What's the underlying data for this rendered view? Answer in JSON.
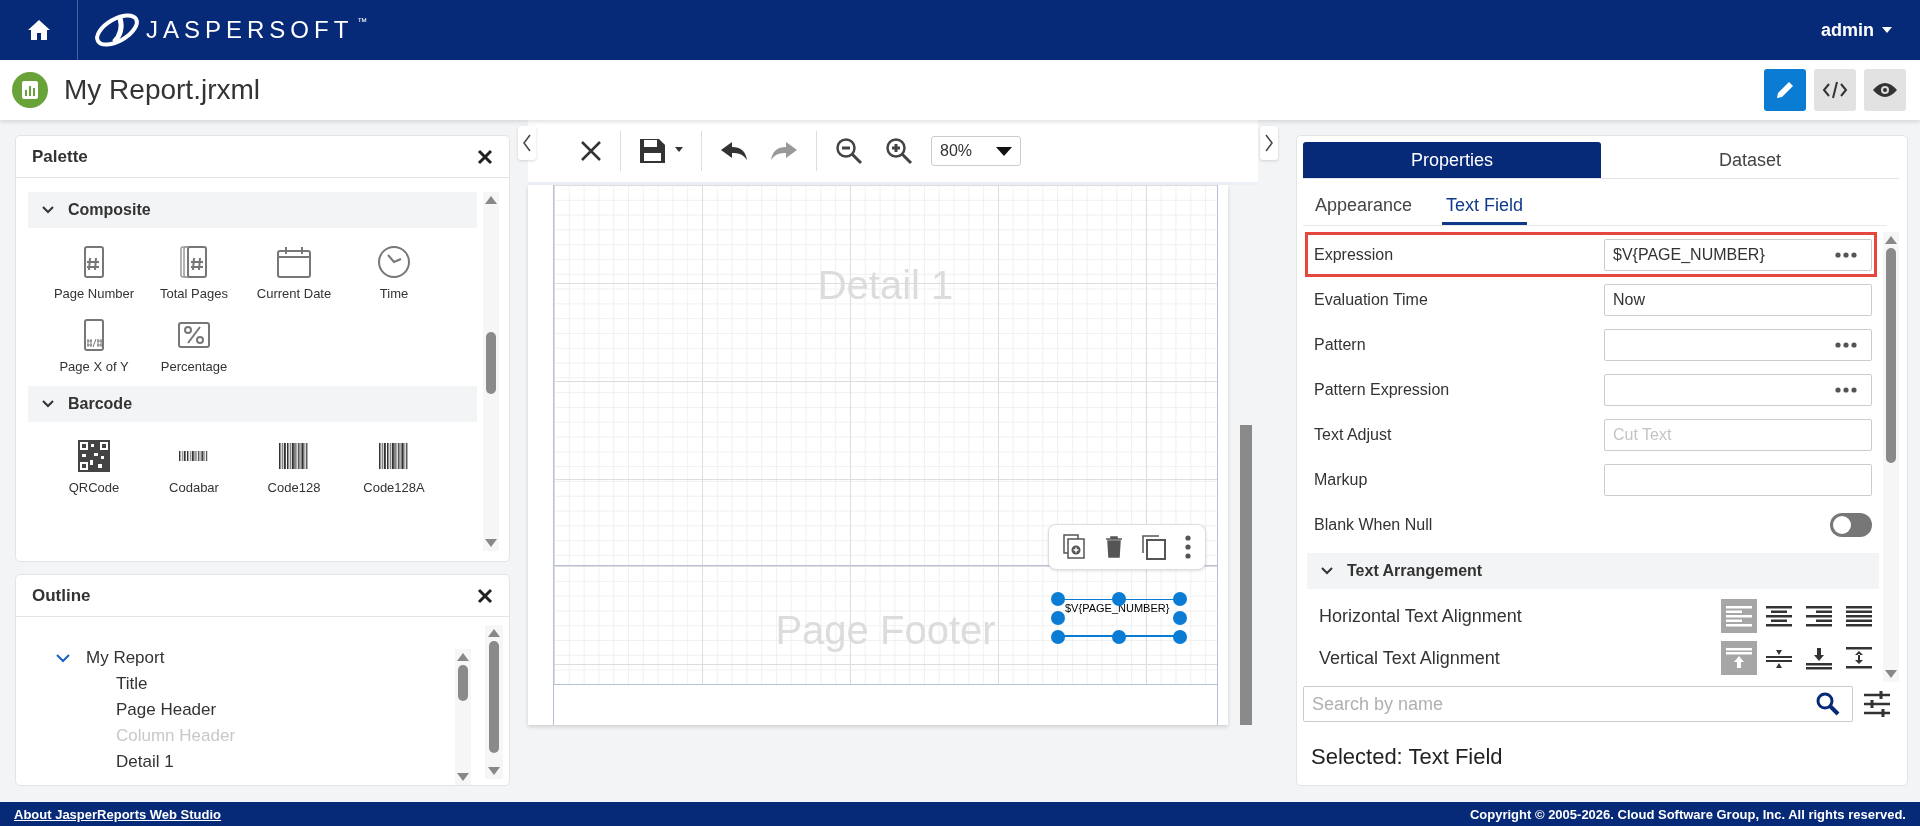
{
  "top_bar": {
    "brand": "JASPERSOFT",
    "trademark": "™",
    "user": "admin"
  },
  "title_bar": {
    "title": "My Report.jrxml",
    "modes": [
      {
        "kind": "design",
        "selected": true
      },
      {
        "kind": "source",
        "selected": false
      },
      {
        "kind": "preview",
        "selected": false
      }
    ]
  },
  "palette": {
    "title": "Palette",
    "sections": [
      {
        "label": "Composite",
        "expanded": true,
        "items": [
          {
            "kind": "page-number",
            "label": "Page Number"
          },
          {
            "kind": "total-pages",
            "label": "Total Pages"
          },
          {
            "kind": "date",
            "label": "Current Date"
          },
          {
            "kind": "time",
            "label": "Time"
          },
          {
            "kind": "page-x-of-y",
            "label": "Page X of Y"
          },
          {
            "kind": "percentage",
            "label": "Percentage"
          }
        ]
      },
      {
        "label": "Barcode",
        "expanded": true,
        "items": [
          {
            "kind": "qrcode",
            "label": "QRCode"
          },
          {
            "kind": "codabar",
            "label": "Codabar"
          },
          {
            "kind": "code128",
            "label": "Code128"
          },
          {
            "kind": "code128a",
            "label": "Code128A"
          }
        ]
      }
    ]
  },
  "outline": {
    "title": "Outline",
    "tree": [
      {
        "label": "My Report",
        "expanded": true,
        "disabled": false,
        "children": [
          {
            "label": "Title",
            "disabled": false
          },
          {
            "label": "Page Header",
            "disabled": false
          },
          {
            "label": "Column Header",
            "disabled": true
          },
          {
            "label": "Detail 1",
            "disabled": false
          }
        ]
      }
    ]
  },
  "toolbar": {
    "zoom": "80%"
  },
  "canvas": {
    "bands": [
      {
        "kind": "detail",
        "label": "Detail 1"
      },
      {
        "kind": "footer",
        "label": "Page Footer",
        "selected_element": "$V{PAGE_NUMBER}"
      }
    ]
  },
  "properties": {
    "tabs": [
      {
        "label": "Properties",
        "selected": true
      },
      {
        "label": "Dataset",
        "selected": false
      }
    ],
    "subtabs": [
      {
        "label": "Appearance",
        "selected": false
      },
      {
        "label": "Text Field",
        "selected": true
      }
    ],
    "rows": [
      {
        "kind": "field",
        "label": "Expression",
        "value": "$V{PAGE_NUMBER}",
        "more": true,
        "highlighted": true
      },
      {
        "kind": "field",
        "label": "Evaluation Time",
        "value": "Now",
        "more": false,
        "highlighted": false
      },
      {
        "kind": "field",
        "label": "Pattern",
        "more": true,
        "highlighted": false
      },
      {
        "kind": "field",
        "label": "Pattern Expression",
        "more": true,
        "highlighted": false
      },
      {
        "kind": "field",
        "label": "Text Adjust",
        "placeholder": "Cut Text",
        "more": false,
        "highlighted": false
      },
      {
        "kind": "field",
        "label": "Markup",
        "more": false,
        "highlighted": false
      },
      {
        "kind": "toggle",
        "label": "Blank When Null",
        "on": false,
        "highlighted": false
      }
    ],
    "section": {
      "label": "Text Arrangement",
      "expanded": true,
      "rows": [
        {
          "kind": "horizontal",
          "label": "Horizontal Text Alignment",
          "options": [
            {
              "selected": true
            },
            {
              "selected": false
            },
            {
              "selected": false
            },
            {
              "selected": false
            }
          ]
        },
        {
          "kind": "vertical",
          "label": "Vertical Text Alignment",
          "options": [
            {
              "selected": true
            },
            {
              "selected": false
            },
            {
              "selected": false
            },
            {
              "selected": false
            }
          ]
        }
      ]
    },
    "search": {
      "placeholder": "Search by name"
    },
    "status": "Selected: Text Field"
  },
  "footer": {
    "link": "About JasperReports Web Studio",
    "copyright": "Copyright © 2005-2026. Cloud Software Group, Inc. All rights reserved."
  }
}
